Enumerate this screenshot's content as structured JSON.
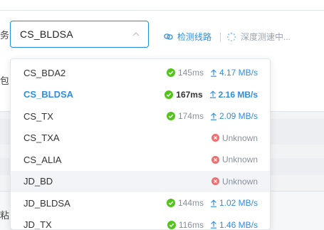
{
  "background": {
    "left_char_top": "务",
    "left_char_mid": "包",
    "left_char_bottom": "粘"
  },
  "line_select": {
    "selected_value": "CS_BLDSA",
    "detect_label": "检测线路",
    "speed_label": "深度测速中..."
  },
  "options": [
    {
      "name": "CS_BDA2",
      "status": "ok",
      "latency": "145ms",
      "bandwidth": "4.17 MB/s"
    },
    {
      "name": "CS_BLDSA",
      "status": "ok",
      "latency": "167ms",
      "bandwidth": "2.16 MB/s"
    },
    {
      "name": "CS_TX",
      "status": "ok",
      "latency": "174ms",
      "bandwidth": "2.09 MB/s"
    },
    {
      "name": "CS_TXA",
      "status": "unknown",
      "unknown_label": "Unknown"
    },
    {
      "name": "CS_ALIA",
      "status": "unknown",
      "unknown_label": "Unknown"
    },
    {
      "name": "JD_BD",
      "status": "unknown",
      "unknown_label": "Unknown"
    },
    {
      "name": "JD_BLDSA",
      "status": "ok",
      "latency": "144ms",
      "bandwidth": "1.02 MB/s"
    },
    {
      "name": "JD_TX",
      "status": "ok",
      "latency": "116ms",
      "bandwidth": "1.46 MB/s"
    }
  ],
  "colors": {
    "accent": "#2f8ee0",
    "ok": "#52c41a",
    "error": "#f56c6c"
  }
}
